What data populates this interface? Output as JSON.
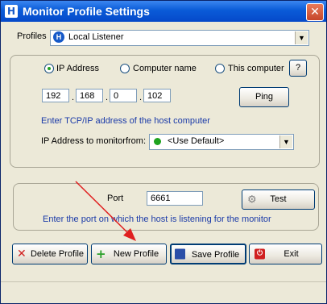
{
  "window": {
    "title": "Monitor Profile Settings",
    "app_icon_glyph": "H"
  },
  "profiles": {
    "label": "Profiles",
    "selected": "Local Listener"
  },
  "address": {
    "options": [
      "IP Address",
      "Computer name",
      "This computer"
    ],
    "selected": "IP Address",
    "help_label": "?",
    "ip": [
      "192",
      "168",
      "0",
      "102"
    ],
    "ping_label": "Ping",
    "hint": "Enter TCP/IP address of the host computer",
    "monitor_from_label": "IP Address to monitorfrom:",
    "monitor_from_value": "<Use Default>"
  },
  "port": {
    "label": "Port",
    "value": "6661",
    "test_label": "Test",
    "hint": "Enter the port on which the host is listening for the monitor"
  },
  "actions": {
    "delete_label": "Delete Profile",
    "new_label": "New Profile",
    "save_label": "Save Profile",
    "exit_label": "Exit"
  },
  "colors": {
    "title_bar": "#0a5bd8",
    "hint_text": "#1a3aa8",
    "annotation_arrow": "#e02020"
  }
}
